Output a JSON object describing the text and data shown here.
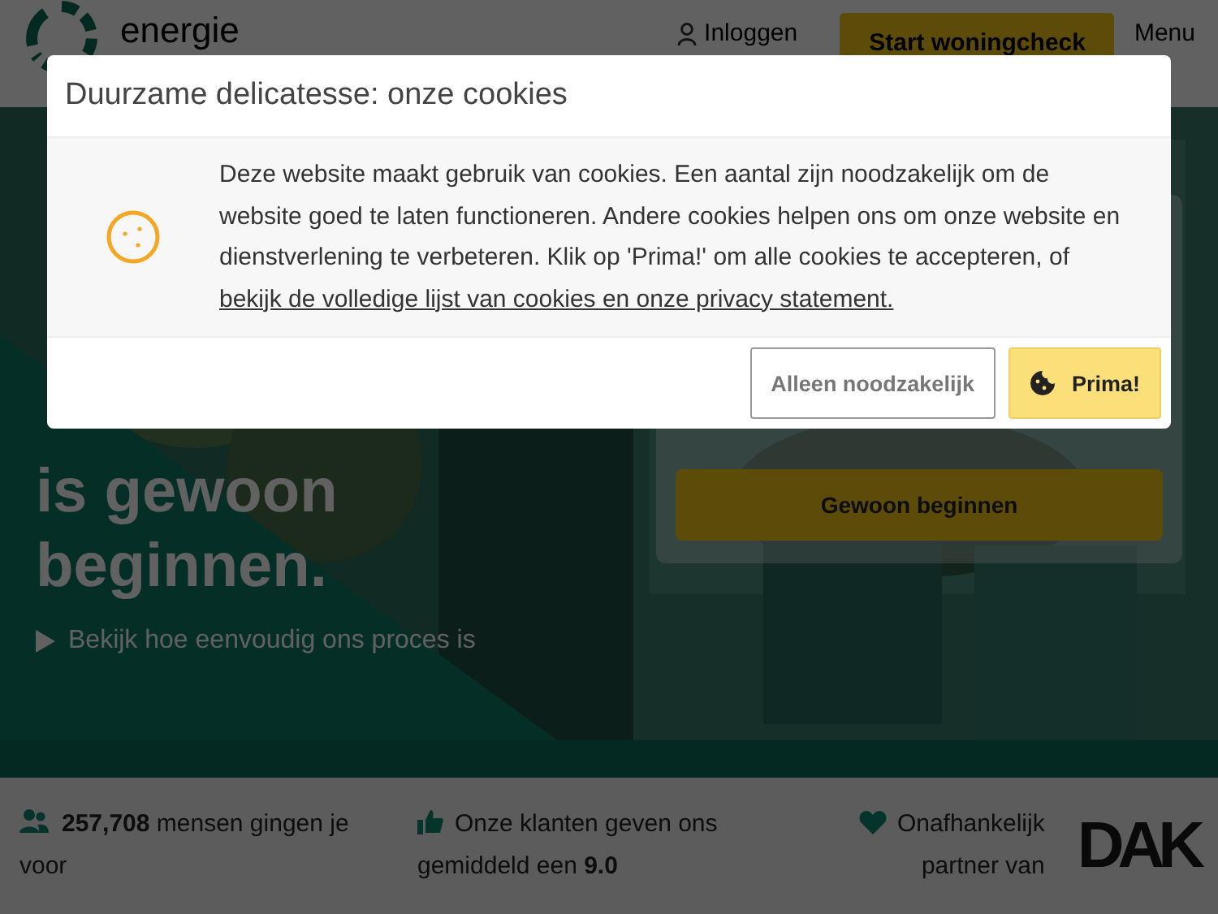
{
  "header": {
    "logo_text": "energie",
    "login": "Inloggen",
    "cta": "Start woningcheck",
    "menu": "Menu"
  },
  "hero": {
    "kind": "picture",
    "title_lines": [
      "is gewoon",
      "beginnen."
    ],
    "video_link": "Bekijk hoe eenvoudig ons proces is",
    "start_button": "Gewoon beginnen"
  },
  "stats": [
    {
      "kind": "people",
      "text": "**257,708** mensen gingen je voor"
    },
    {
      "kind": "thumb",
      "text": "Onze klanten geven ons gemiddeld een **9.0**"
    },
    {
      "kind": "heart",
      "text": "Onafhankelijk partner van"
    }
  ],
  "partner_logo": "DAK",
  "cookie_dialog": {
    "title": "Duurzame delicatesse: onze cookies",
    "body": "Deze website maakt gebruik van cookies. Een aantal zijn noodzakelijk om de website goed te laten functioneren. Andere cookies helpen ons om onze website en dienstverlening te verbeteren. Klik op 'Prima!' om alle cookies te accepteren, of ",
    "link": "bekijk de volledige lijst van cookies en onze privacy statement.",
    "buttons": [
      {
        "kind": "secondary",
        "label": "Alleen noodzakelijk"
      },
      {
        "kind": "primary",
        "label": "Prima!"
      }
    ]
  }
}
